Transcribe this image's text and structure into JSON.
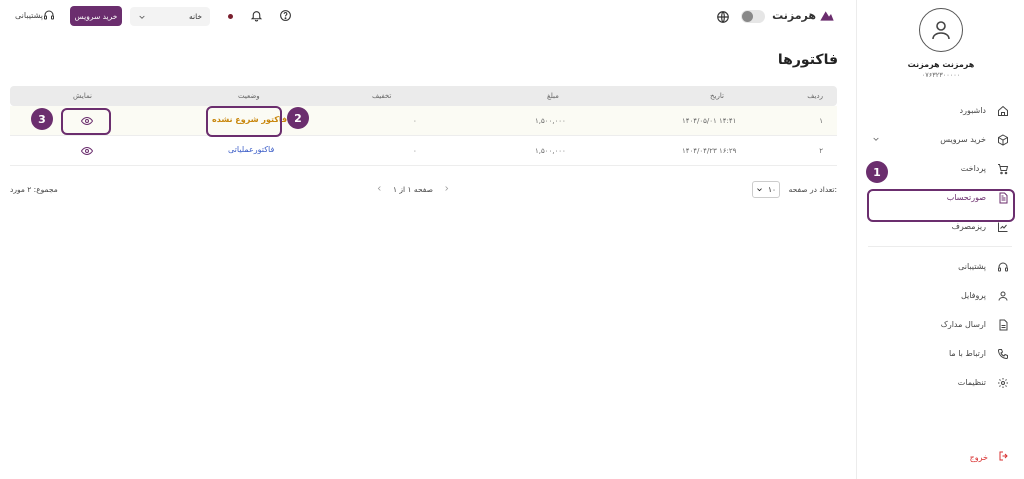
{
  "brand": {
    "name": "هرمزنت",
    "color": "#6b2e6e"
  },
  "topbar": {
    "support_label": "پشتیبانی",
    "buy_label": "خرید سرویس",
    "home_select_value": "خانه"
  },
  "user": {
    "name": "هرمزنت هرمزنت",
    "phone": "۰۷۶۳۲۳۰۰۰۰۰"
  },
  "sidebar": {
    "items": [
      {
        "label": "داشبورد",
        "icon": "home-icon"
      },
      {
        "label": "خرید سرویس",
        "icon": "box-icon"
      },
      {
        "label": "پرداخت",
        "icon": "cart-icon"
      },
      {
        "label": "صورتحساب",
        "icon": "invoice-icon"
      },
      {
        "label": "ریزمصرف",
        "icon": "chart-icon"
      },
      {
        "label": "پشتیبانی",
        "icon": "headset-icon"
      },
      {
        "label": "پروفایل",
        "icon": "user-icon"
      },
      {
        "label": "ارسال مدارک",
        "icon": "document-icon"
      },
      {
        "label": "ارتباط با ما",
        "icon": "phone-icon"
      },
      {
        "label": "تنظیمات",
        "icon": "gear-icon"
      }
    ],
    "logout_label": "خروج"
  },
  "page": {
    "title": "فاکتورها"
  },
  "table": {
    "headers": {
      "row": "ردیف",
      "date": "تاریخ",
      "amount": "مبلغ",
      "discount": "تخفیف",
      "status": "وضعیت",
      "view": "نمایش"
    },
    "rows": [
      {
        "row": "۱",
        "date": "۱۴۰۴/۰۵/۰۱ ۱۴:۴۱",
        "amount": "۱,۵۰۰,۰۰۰",
        "discount": "۰",
        "status": "فاکتور شروع نشده"
      },
      {
        "row": "۲",
        "date": "۱۴۰۴/۰۴/۲۳ ۱۶:۲۹",
        "amount": "۱,۵۰۰,۰۰۰",
        "discount": "۰",
        "status": "فاکتورعملیاتی"
      }
    ]
  },
  "pager": {
    "page_size_label": "تعداد در صفحه:",
    "page_size": "۱۰",
    "page_info": "صفحه ۱ از ۱",
    "total": "مجموع: ۲ مورد"
  },
  "annotations": [
    "1",
    "2",
    "3"
  ]
}
